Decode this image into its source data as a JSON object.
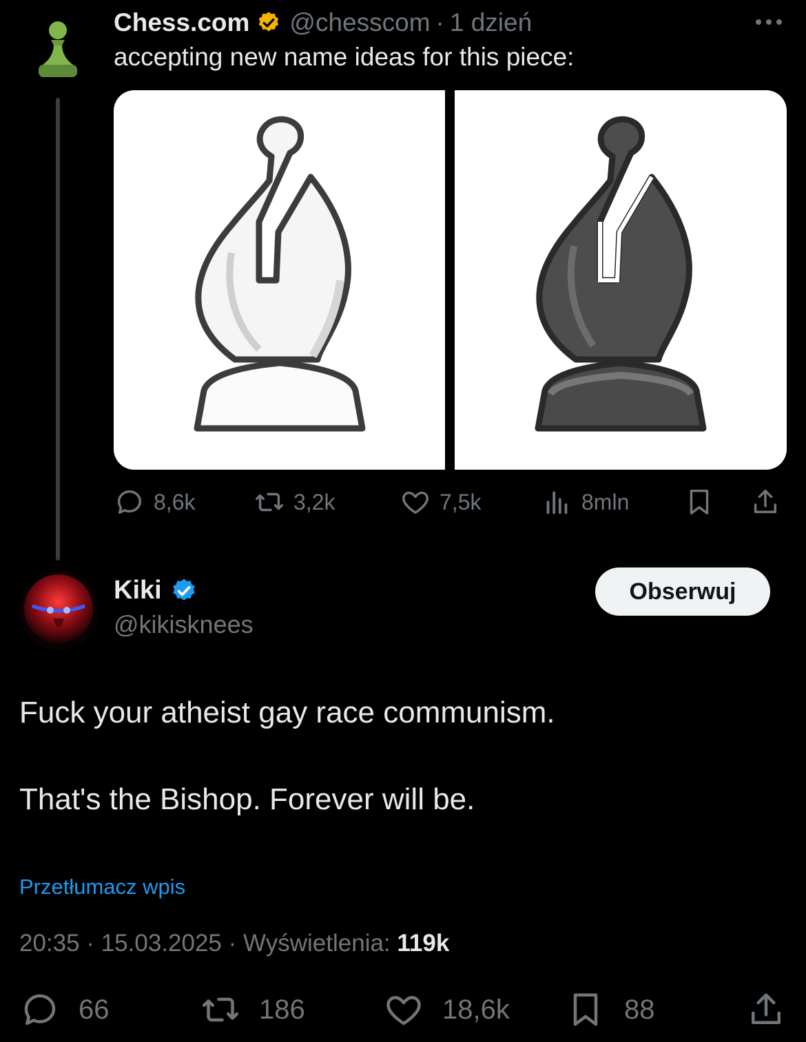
{
  "parent": {
    "display_name": "Chess.com",
    "handle": "@chesscom",
    "separator": "·",
    "time": "1 dzień",
    "text": "accepting new name ideas for this piece:",
    "stats": {
      "replies": "8,6k",
      "reposts": "3,2k",
      "likes": "7,5k",
      "views": "8mln"
    }
  },
  "reply": {
    "display_name": "Kiki",
    "handle": "@kikisknees",
    "follow_label": "Obserwuj",
    "paragraph_1": "Fuck your atheist gay race communism.",
    "paragraph_2": "That's the Bishop. Forever will be.",
    "translate_label": "Przetłumacz wpis",
    "time": "20:35",
    "date": "15.03.2025",
    "views_label": "Wyświetlenia:",
    "views_count": "119k",
    "stats": {
      "replies": "66",
      "reposts": "186",
      "likes": "18,6k",
      "bookmarks": "88"
    }
  },
  "colors": {
    "background": "#000000",
    "text": "#e7e9ea",
    "muted": "#71767b",
    "link": "#1d9bf0",
    "verified_gold": "#f4b400",
    "verified_blue": "#1d9bf0",
    "chess_green": "#81b64c"
  },
  "icons": [
    "pawn-avatar",
    "verified-gold-badge",
    "more-icon",
    "reply-icon",
    "repost-icon",
    "like-icon",
    "views-icon",
    "bookmark-icon",
    "share-icon",
    "verified-blue-badge"
  ]
}
